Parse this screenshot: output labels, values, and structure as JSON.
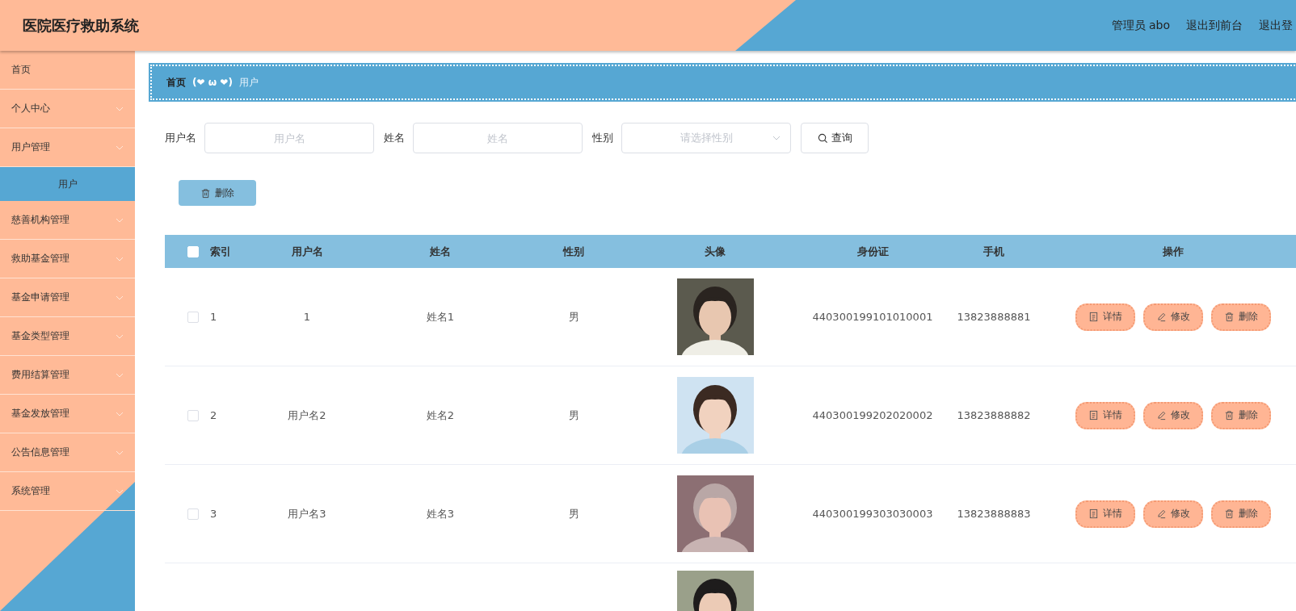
{
  "header": {
    "title": "医院医疗救助系统",
    "user": "管理员 abo",
    "links": [
      "退出到前台",
      "退出登"
    ]
  },
  "sidebar": {
    "items": [
      {
        "label": "首页",
        "expandable": false,
        "selected": false
      },
      {
        "label": "个人中心",
        "expandable": true,
        "selected": false
      },
      {
        "label": "用户管理",
        "expandable": true,
        "selected": false,
        "children": [
          {
            "label": "用户",
            "selected": true
          }
        ]
      },
      {
        "label": "慈善机构管理",
        "expandable": true,
        "selected": false
      },
      {
        "label": "救助基金管理",
        "expandable": true,
        "selected": false
      },
      {
        "label": "基金申请管理",
        "expandable": true,
        "selected": false
      },
      {
        "label": "基金类型管理",
        "expandable": true,
        "selected": false
      },
      {
        "label": "费用结算管理",
        "expandable": true,
        "selected": false
      },
      {
        "label": "基金发放管理",
        "expandable": true,
        "selected": false
      },
      {
        "label": "公告信息管理",
        "expandable": true,
        "selected": false
      },
      {
        "label": "系统管理",
        "expandable": true,
        "selected": false
      }
    ]
  },
  "breadcrumb": {
    "items": [
      "首页",
      "用户"
    ],
    "separator": "(❤ ω ❤)"
  },
  "search": {
    "fields": [
      {
        "kind": "input",
        "label": "用户名",
        "placeholder": "用户名"
      },
      {
        "kind": "input",
        "label": "姓名",
        "placeholder": "姓名"
      },
      {
        "kind": "select",
        "label": "性别",
        "placeholder": "请选择性别"
      }
    ],
    "button": "查询"
  },
  "toolbar": {
    "delete_button": "删除"
  },
  "table": {
    "all_checked": false,
    "columns": [
      "索引",
      "用户名",
      "姓名",
      "性别",
      "头像",
      "身份证",
      "手机",
      "操作"
    ],
    "rows": [
      {
        "checked": false,
        "index": "1",
        "username": "1",
        "name": "姓名1",
        "gender": "男",
        "avatar": {
          "kind": "picture"
        },
        "id_card": "440300199101010001",
        "phone": "13823888881",
        "actions": [
          "详情",
          "修改",
          "删除"
        ]
      },
      {
        "checked": false,
        "index": "2",
        "username": "用户名2",
        "name": "姓名2",
        "gender": "男",
        "avatar": {
          "kind": "picture"
        },
        "id_card": "440300199202020002",
        "phone": "13823888882",
        "actions": [
          "详情",
          "修改",
          "删除"
        ]
      },
      {
        "checked": false,
        "index": "3",
        "username": "用户名3",
        "name": "姓名3",
        "gender": "男",
        "avatar": {
          "kind": "picture"
        },
        "id_card": "440300199303030003",
        "phone": "13823888883",
        "actions": [
          "详情",
          "修改",
          "删除"
        ]
      },
      {
        "avatar": {
          "kind": "picture"
        }
      }
    ]
  }
}
